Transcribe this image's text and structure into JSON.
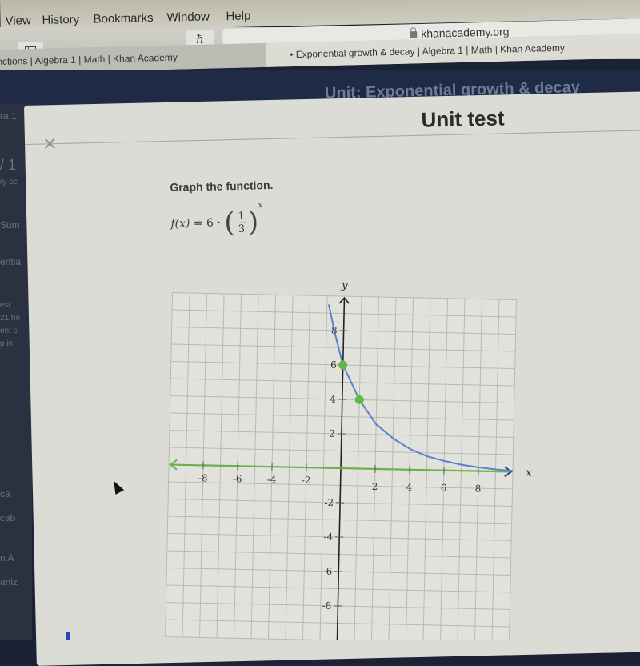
{
  "menubar": {
    "items": [
      "View",
      "History",
      "Bookmarks",
      "Window",
      "Help"
    ]
  },
  "toolbar": {
    "sidebar_icon": "sidebar-toggle-icon",
    "khan_icon_glyph": "ħ",
    "url": "khanacademy.org",
    "lock_icon": "lock-icon"
  },
  "tabs": [
    {
      "label": "nctions | Algebra 1 | Math | Khan Academy",
      "active": false
    },
    {
      "label": "• Exponential growth & decay | Algebra 1 | Math | Khan Academy",
      "active": true
    }
  ],
  "site_header": {
    "unit_title": "Unit: Exponential growth & decay"
  },
  "background_fragments": [
    "ra 1",
    "/ 1",
    "ry pc",
    "Sum",
    "entia",
    "est",
    "21 ho",
    "ent s",
    "p in",
    "ca",
    "cab",
    "n A",
    "aniz"
  ],
  "modal": {
    "close_glyph": "×",
    "title": "Unit test",
    "prompt": "Graph the function.",
    "formula": {
      "lhs": "f(x)",
      "equals": "=",
      "coef": "6",
      "dot": "·",
      "num": "1",
      "den": "3",
      "exponent": "x"
    }
  },
  "chart_data": {
    "type": "line",
    "title": "",
    "xlabel": "x",
    "ylabel": "y",
    "xlim": [
      -10,
      10
    ],
    "ylim": [
      -10,
      10
    ],
    "grid": true,
    "x_ticks": [
      -8,
      -6,
      -4,
      -2,
      2,
      4,
      6,
      8
    ],
    "y_ticks": [
      8,
      6,
      4,
      2,
      -2,
      -4,
      -6,
      -8
    ],
    "series": [
      {
        "name": "f(x) = 6·(1/3)^x (plotted curve)",
        "color": "#5b80c8",
        "x": [
          -0.9,
          -0.5,
          0,
          0.5,
          1,
          1.5,
          2,
          3,
          4,
          5,
          6,
          7,
          8,
          9,
          10
        ],
        "y": [
          9.5,
          7.8,
          6.0,
          5.0,
          4.0,
          3.3,
          2.6,
          1.8,
          1.2,
          0.8,
          0.55,
          0.35,
          0.22,
          0.12,
          0.05
        ]
      },
      {
        "name": "asymptote",
        "color": "#6ab04c",
        "x": [
          -10,
          10
        ],
        "y": [
          0,
          0
        ]
      }
    ],
    "points": [
      {
        "x": 0,
        "y": 6,
        "color": "#5fb84a"
      },
      {
        "x": 1,
        "y": 4,
        "color": "#5fb84a"
      }
    ]
  }
}
